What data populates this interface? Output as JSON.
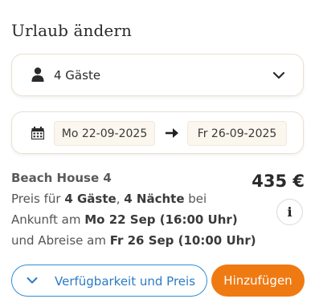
{
  "dialog": {
    "title": "Urlaub ändern"
  },
  "guests": {
    "label": "4 Gäste",
    "icon": "person-icon",
    "toggle_icon": "chevron-down-icon"
  },
  "dates": {
    "from": "Mo 22-09-2025",
    "to": "Fr 26-09-2025",
    "icon": "calendar-icon",
    "separator_icon": "arrow-right-icon"
  },
  "summary": {
    "property": "Beach House 4",
    "price": "435 €",
    "line1_prefix": "Preis für ",
    "guests_bold": "4 Gäste",
    "comma": ", ",
    "nights_bold": "4 Nächte",
    "line1_suffix": " bei",
    "line2_prefix": "Ankunft am ",
    "arrival_bold": "Mo 22 Sep (16:00 Uhr)",
    "line3_prefix": "und Abreise am ",
    "departure_bold": "Fr 26 Sep (10:00 Uhr)",
    "info_label": "i"
  },
  "actions": {
    "availability_label": "Verfügbarkeit und Preis",
    "add_label": "Hinzufügen"
  },
  "colors": {
    "accent_orange": "#ef7a12",
    "accent_blue": "#2d8ed6",
    "date_bg": "#fbf6ee"
  }
}
